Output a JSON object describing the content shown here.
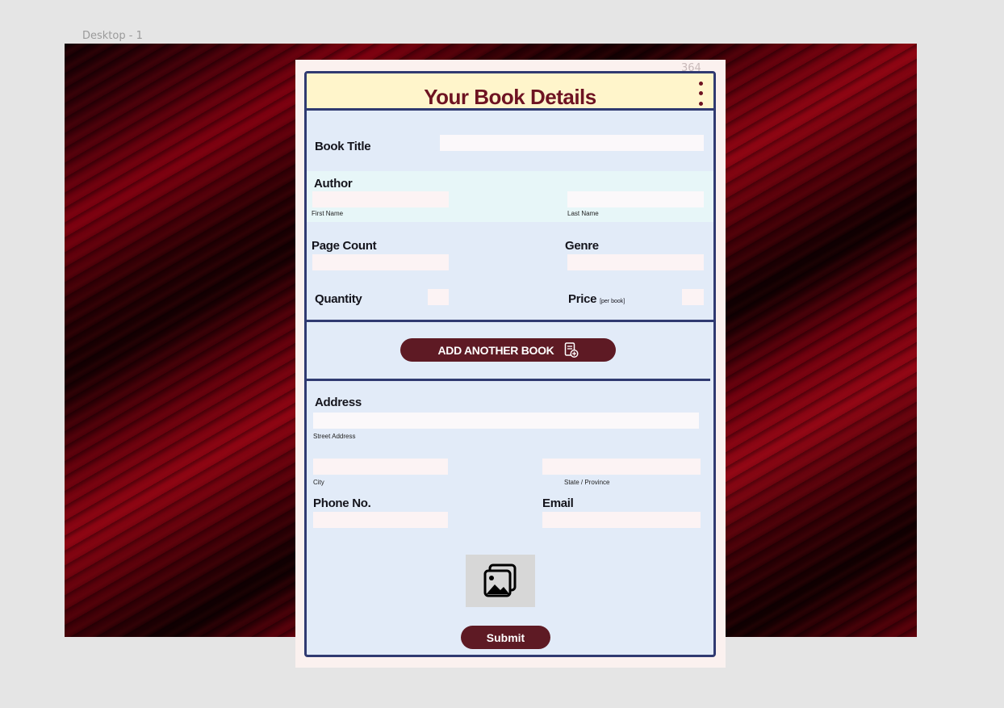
{
  "canvas": {
    "frame_label": "Desktop - 1",
    "frame_number": "364"
  },
  "colors": {
    "accent": "#5e1a24",
    "title": "#6e1322",
    "border": "#303a71",
    "header_bg": "#fff5cb",
    "card_bg": "#e2ebf8"
  },
  "form": {
    "title": "Your Book Details",
    "menu_icon": "kebab-menu-icon",
    "book_title_label": "Book Title",
    "author_label": "Author",
    "first_name_sub": "First Name",
    "last_name_sub": "Last Name",
    "page_count_label": "Page Count",
    "genre_label": "Genre",
    "quantity_label": "Quantity",
    "price_label": "Price",
    "price_note": "[per book]",
    "add_book_label": "ADD ANOTHER BOOK",
    "add_book_icon": "add-document-icon",
    "address_label": "Address",
    "street_sub": "Street Address",
    "city_sub": "City",
    "state_sub": "State / Province",
    "phone_label": "Phone No.",
    "email_label": "Email",
    "image_icon": "image-gallery-icon",
    "submit_label": "Submit"
  },
  "fields": {
    "book_title": "",
    "first_name": "",
    "last_name": "",
    "page_count": "",
    "genre": "",
    "quantity": "",
    "price": "",
    "street": "",
    "city": "",
    "state": "",
    "phone": "",
    "email": ""
  }
}
